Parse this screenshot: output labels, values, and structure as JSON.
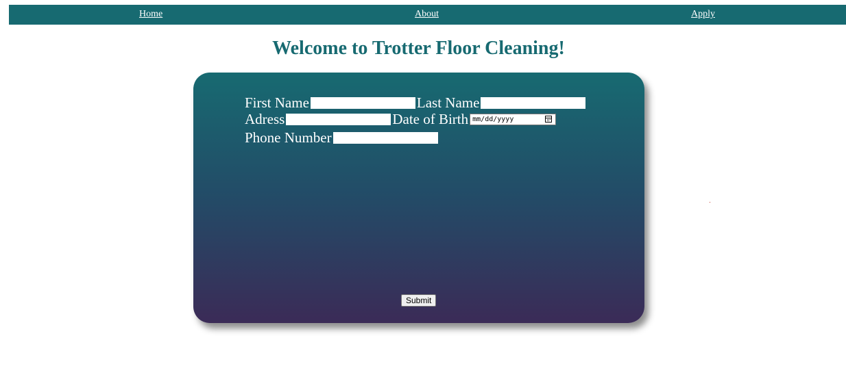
{
  "nav": {
    "home_label": "Home",
    "about_label": "About",
    "apply_label": "Apply"
  },
  "page": {
    "title": "Welcome to Trotter Floor Cleaning!"
  },
  "form": {
    "first_name_label": "First Name",
    "first_name_value": "",
    "last_name_label": "Last Name",
    "last_name_value": "",
    "address_label": "Adress",
    "address_value": "",
    "dob_label": "Date of Birth",
    "dob_placeholder": "mm/dd/yyyy",
    "phone_label": "Phone Number",
    "phone_value": "",
    "submit_label": "Submit"
  },
  "colors": {
    "brand_teal": "#176a71",
    "gradient_bottom": "#3b2b57"
  },
  "icons": {
    "date_picker": "calendar-icon"
  }
}
